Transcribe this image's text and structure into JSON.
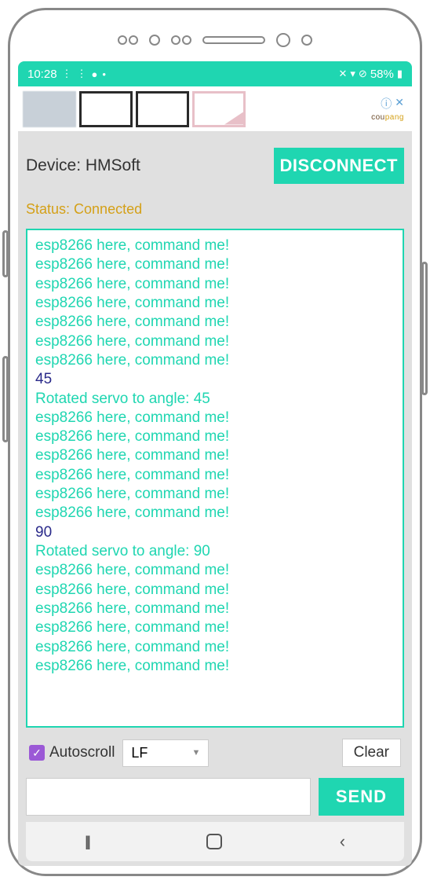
{
  "statusbar": {
    "time": "10:28",
    "battery": "58%",
    "icons_left": [
      "⋮",
      "⋮",
      "●",
      "•"
    ],
    "icons_right": [
      "🔇",
      "📶",
      "⊘"
    ]
  },
  "ad": {
    "brand": "coupang",
    "info_glyph": "ⓘ",
    "close_glyph": "✕"
  },
  "device": {
    "label_prefix": "Device: ",
    "name": "HMSoft"
  },
  "buttons": {
    "disconnect": "DISCONNECT",
    "clear": "Clear",
    "send": "SEND"
  },
  "status": {
    "prefix": "Status: ",
    "value": "Connected"
  },
  "console_lines": [
    {
      "dir": "rx",
      "text": "esp8266 here, command me!"
    },
    {
      "dir": "rx",
      "text": "esp8266 here, command me!"
    },
    {
      "dir": "rx",
      "text": "esp8266 here, command me!"
    },
    {
      "dir": "rx",
      "text": "esp8266 here, command me!"
    },
    {
      "dir": "rx",
      "text": "esp8266 here, command me!"
    },
    {
      "dir": "rx",
      "text": "esp8266 here, command me!"
    },
    {
      "dir": "rx",
      "text": "esp8266 here, command me!"
    },
    {
      "dir": "tx",
      "text": "45"
    },
    {
      "dir": "rx",
      "text": "Rotated servo to angle: 45"
    },
    {
      "dir": "rx",
      "text": "esp8266 here, command me!"
    },
    {
      "dir": "rx",
      "text": "esp8266 here, command me!"
    },
    {
      "dir": "rx",
      "text": "esp8266 here, command me!"
    },
    {
      "dir": "rx",
      "text": "esp8266 here, command me!"
    },
    {
      "dir": "rx",
      "text": "esp8266 here, command me!"
    },
    {
      "dir": "rx",
      "text": "esp8266 here, command me!"
    },
    {
      "dir": "tx",
      "text": "90"
    },
    {
      "dir": "rx",
      "text": "Rotated servo to angle: 90"
    },
    {
      "dir": "rx",
      "text": "esp8266 here, command me!"
    },
    {
      "dir": "rx",
      "text": "esp8266 here, command me!"
    },
    {
      "dir": "rx",
      "text": "esp8266 here, command me!"
    },
    {
      "dir": "rx",
      "text": "esp8266 here, command me!"
    },
    {
      "dir": "rx",
      "text": "esp8266 here, command me!"
    },
    {
      "dir": "rx",
      "text": "esp8266 here, command me!"
    }
  ],
  "controls": {
    "autoscroll_label": "Autoscroll",
    "autoscroll_checked": true,
    "line_ending": "LF"
  },
  "input": {
    "value": ""
  },
  "nav": {
    "recent": "|||",
    "back": "‹"
  }
}
